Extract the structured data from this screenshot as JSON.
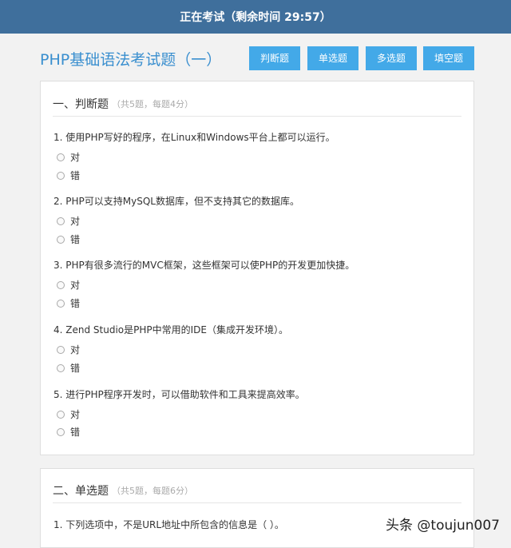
{
  "topbar": {
    "status": "正在考试（剩余时间 29:57）"
  },
  "exam": {
    "title": "PHP基础语法考试题（一）"
  },
  "nav": [
    "判断题",
    "单选题",
    "多选题",
    "填空题"
  ],
  "sections": [
    {
      "title": "一、判断题",
      "note": "（共5题，每题4分）",
      "questions": [
        {
          "text": "1. 使用PHP写好的程序，在Linux和Windows平台上都可以运行。",
          "options": [
            "对",
            "错"
          ]
        },
        {
          "text": "2. PHP可以支持MySQL数据库，但不支持其它的数据库。",
          "options": [
            "对",
            "错"
          ]
        },
        {
          "text": "3. PHP有很多流行的MVC框架，这些框架可以使PHP的开发更加快捷。",
          "options": [
            "对",
            "错"
          ]
        },
        {
          "text": "4. Zend Studio是PHP中常用的IDE（集成开发环境）。",
          "options": [
            "对",
            "错"
          ]
        },
        {
          "text": "5. 进行PHP程序开发时，可以借助软件和工具来提高效率。",
          "options": [
            "对",
            "错"
          ]
        }
      ]
    },
    {
      "title": "二、单选题",
      "note": "（共5题，每题6分）",
      "questions": [
        {
          "text": "1. 下列选项中，不是URL地址中所包含的信息是（ ）。",
          "options": []
        }
      ]
    }
  ],
  "watermark": "头条 @toujun007"
}
